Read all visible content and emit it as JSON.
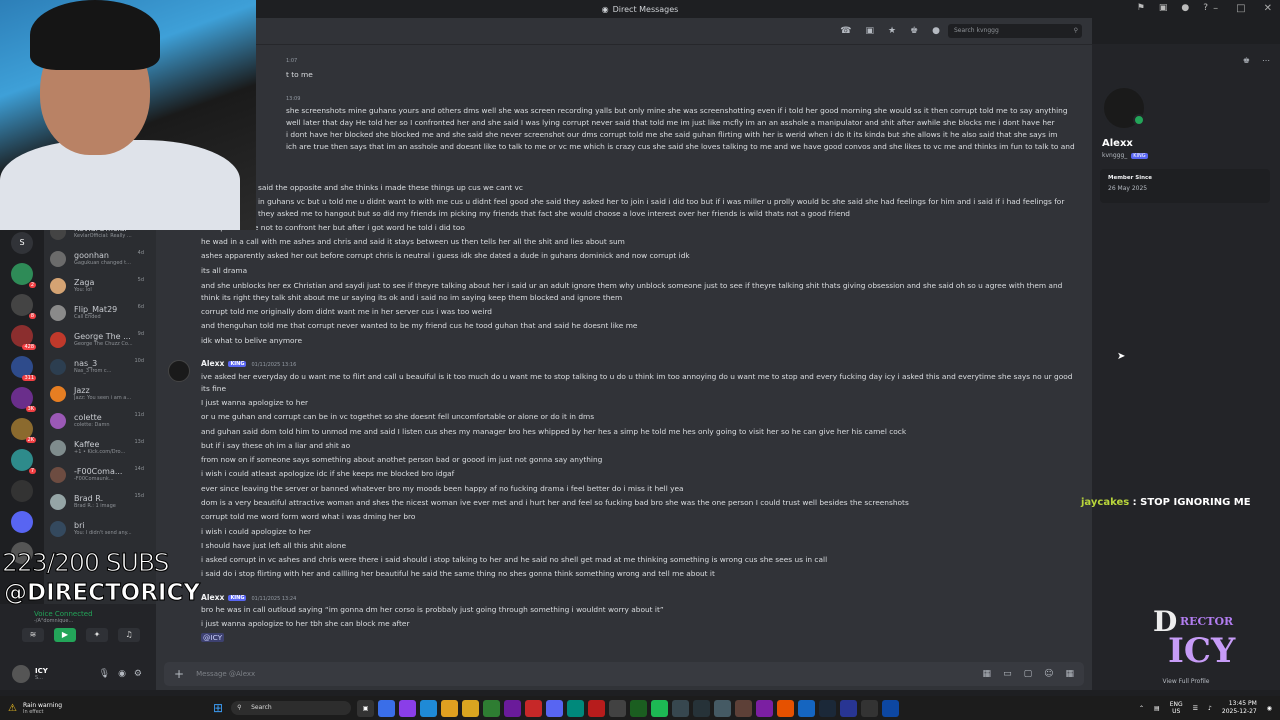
{
  "window": {
    "title": "Direct Messages"
  },
  "search": {
    "placeholder": "Search kvnggg"
  },
  "sidebar": {
    "items": [
      {
        "name": "KevlarOfficial",
        "sub": "KevlarOfficial: Really ...",
        "time": "",
        "color": "#444"
      },
      {
        "name": "goonhan",
        "sub": "Gagukuan changed t...",
        "time": "4d",
        "color": "#6b6b6b"
      },
      {
        "name": "Zaga",
        "sub": "You: lol",
        "time": "5d",
        "color": "#d4a373"
      },
      {
        "name": "Flip_Mat29",
        "sub": "Call Ended",
        "time": "6d",
        "color": "#8a8a8a"
      },
      {
        "name": "George The ...",
        "sub": "George The Chuzz Co...",
        "time": "9d",
        "color": "#c0392b"
      },
      {
        "name": "nas_3",
        "sub": "Nas_3 from c...",
        "time": "10d",
        "color": "#2c3e50"
      },
      {
        "name": "Jazz",
        "sub": "Jazz: You seen i am a...",
        "time": "",
        "color": "#e67e22"
      },
      {
        "name": "colette",
        "sub": "colette: Damn",
        "time": "11d",
        "color": "#9b59b6"
      },
      {
        "name": "Kaffee",
        "sub": "+1 • Kick.com/Dro...",
        "time": "13d",
        "color": "#7f8c8d"
      },
      {
        "name": "-F00Coma...",
        "sub": "-F00Comaunk...",
        "time": "14d",
        "color": "#6d4c41"
      },
      {
        "name": "Brad R.",
        "sub": "Brad R.: 1 image",
        "time": "15d",
        "color": "#95a5a6"
      },
      {
        "name": "bri",
        "sub": "You: I didn't send any...",
        "time": "",
        "color": "#34495e"
      }
    ]
  },
  "voice": {
    "status": "Voice Connected",
    "sub": "-/A°domnique..."
  },
  "user": {
    "name": "ICY",
    "status": "S..."
  },
  "messages": {
    "line01": "1:07",
    "line02": "t to me",
    "line03": "13:09",
    "line04": "she screenshots mine guhans yours and others dms well she was screen recording yalls but only mine she was screenshotting even if i told her good morning she would ss it then corrupt told me to say anything",
    "line05": "well later that day He told her so I confronted her and she said I was lying corrupt never said that told me im just like mcfly im an an asshole a manipulator and shit after awhile she blocks me i dont have her",
    "line06": "i dont have her blocked she blocked me and she said she never screenshot our dms corrupt told me she said guhan flirting with her is werid when i do it its kinda but she allows it he also said that she says im",
    "line07": "ich are true then says that im an asshole and doesnt like to talk to me or vc me which is crazy cus she said she loves talking to me and we have good convos and she likes to vc me and thinks im fun to talk to and",
    "line08": "said the opposite and she thinks i made these things up cus we cant vc",
    "line09": "in guhans vc but u told me u didnt want to with me cus u didnt feel good she said they asked her to join i said i did too but if i was miller u prolly would bc she said she had feelings for him and i said if i had feelings for",
    "line10": "they asked me to hangout but so did my friends im picking my friends that fact she would choose a love interest over her friends is wild thats not a good friend",
    "line11": "corrupt told me not to confront her but after i got word he told i did too",
    "line12": "he wad in a call with me ashes and chris and said it stays between us then tells her all the shit and lies about sum",
    "line13": "ashes apparently asked her out before corrupt chris is neutral i guess idk she dated a dude in guhans dominick and now corrupt idk",
    "line14": "its all drama",
    "line15": "and she unblocks her ex Christian and saydi just to see if theyre talking about her i said ur an adult ignore them why unblock someone just to see if theyre talking shit thats giving obsession and she said oh so u agree with them and",
    "line16": "think its right they talk shit about me ur saying its ok and i said no im saying keep them blocked and ignore them",
    "line17": "corrupt told me originally dom didnt want me in her server cus i was too weird",
    "line18": "and thenguhan told me that corrupt never wanted to be my friend cus he tood guhan that and said he doesnt like me",
    "line19": "idk what to belive anymore",
    "author1": "Alexx",
    "tag1": "KING",
    "ts1": "01/11/2025 13:16",
    "line20": "ive asked her everyday do u want me to flirt and call u beauiful is it too much do u want me to stop talking to u do u think im too annoying do u want me to stop and every fucking day icy i asked this and everytime she says no ur good",
    "line21": "its fine",
    "line22": "I just wanna apologize to her",
    "line23": "or u me guhan and corrupt can be in vc togethet so she doesnt fell uncomfortable or alone or do it in dms",
    "line24": "and guhan said dom told him to unmod me and said I listen cus shes my manager bro hes whipped by her hes a simp he told me hes only going to visit her so he can give her his camel cock",
    "line25": "but if i say these oh im a liar and shit ao",
    "line26": "from now on if someone says something about anothet person bad or goood im just not gonna say anything",
    "line27": "i wish i could atleast apologize idc if she keeps me blocked bro idgaf",
    "line28": "ever since leaving the server or banned whatever bro my moods been happy af no fucking drama i feel better do i miss it hell yea",
    "line29": "dom is a very beautiful attractive woman and shes the nicest woman ive ever met and i hurt her and feel so fucking bad bro she was the one person I could trust well besides the screenshots",
    "line30": "corrupt told me word form word what i was dming her bro",
    "line31": "i wish i could apologize to her",
    "line32": "I should have just left all this shit alone",
    "line33": "i asked corrupt in vc ashes and chris were there i said should i stop talking to her and he said no shell get mad at me thinking something is wrong cus she sees us in call",
    "line34": "i said do i stop flirting with her and callling her beautiful he said the same thing no shes gonna think something wrong and tell me about it",
    "author2": "Alexx",
    "tag2": "KING",
    "ts2": "01/11/2025 13:24",
    "line35": "bro he was in call outloud saying “im gonna dm her corso is probbaly just going through something i wouldnt worry about it”",
    "line36": "i just wanna apologize to her tbh she can block me after",
    "mention": "@ICY"
  },
  "composer": {
    "placeholder": "Message @Alexx"
  },
  "profile": {
    "name": "Alexx",
    "username": "kvnggg_",
    "tag": "KING",
    "member_since_label": "Member Since",
    "member_since": "26 May 2025",
    "view_full": "View Full Profile"
  },
  "overlay": {
    "subs": "223/200 SUBS",
    "handle": "@DIRECTORICY",
    "chat_user": "jaycakes",
    "chat_text": " : STOP IGNORING ME",
    "logo_line1": "D",
    "logo_line2": "RECTOR",
    "logo_line3": "ICY"
  },
  "taskbar": {
    "weather_title": "Rain warning",
    "weather_sub": "In effect",
    "search": "Search",
    "lang1": "ENG",
    "lang2": "US",
    "time": "13:45 PM",
    "date": "2025-12-27"
  }
}
